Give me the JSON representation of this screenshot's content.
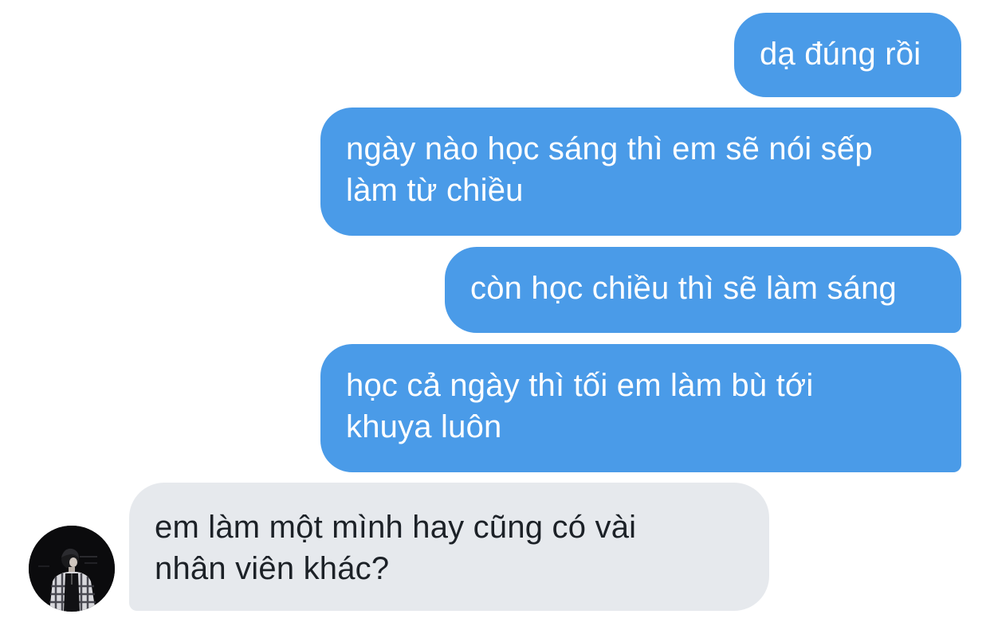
{
  "conversation": {
    "messages": [
      {
        "direction": "outgoing",
        "lines": [
          "dạ đúng rồi"
        ]
      },
      {
        "direction": "outgoing",
        "lines": [
          "ngày nào học sáng thì em sẽ nói sếp",
          "làm từ chiều"
        ]
      },
      {
        "direction": "outgoing",
        "lines": [
          "còn học chiều thì sẽ làm sáng"
        ]
      },
      {
        "direction": "outgoing",
        "lines": [
          "học cả ngày thì tối em làm bù tới",
          "khuya luôn"
        ]
      },
      {
        "direction": "incoming",
        "lines": [
          "em làm một mình hay cũng có vài",
          "nhân viên khác?"
        ]
      }
    ]
  },
  "colors": {
    "outgoing_bubble": "#4a9be8",
    "incoming_bubble": "#e6e9ed",
    "outgoing_text": "#ffffff",
    "incoming_text": "#1c2127"
  },
  "avatar": {
    "icon": "person-photo-icon"
  }
}
